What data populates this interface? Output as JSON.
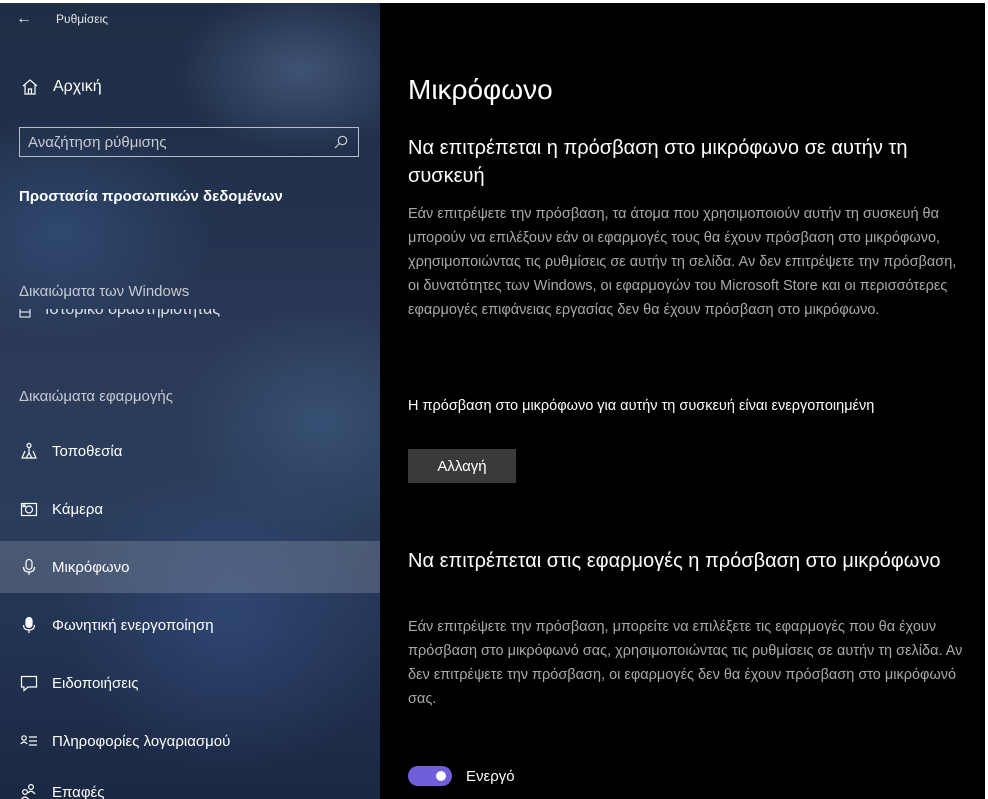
{
  "sidebar": {
    "window_title": "Ρυθμίσεις",
    "home_label": "Αρχική",
    "search_placeholder": "Αναζήτηση ρύθμισης",
    "section_title": "Προστασία προσωπικών δεδομένων",
    "windows_permissions_label": "Δικαιώματα των Windows",
    "activity_history_label": "Ιστορικό δραστηριότητας",
    "app_permissions_label": "Δικαιώματα εφαρμογής",
    "items": [
      {
        "label": "Τοποθεσία",
        "icon": "location-icon"
      },
      {
        "label": "Κάμερα",
        "icon": "camera-icon"
      },
      {
        "label": "Μικρόφωνο",
        "icon": "microphone-icon",
        "selected": true
      },
      {
        "label": "Φωνητική ενεργοποίηση",
        "icon": "voice-activation-icon"
      },
      {
        "label": "Ειδοποιήσεις",
        "icon": "notifications-icon"
      },
      {
        "label": "Πληροφορίες λογαριασμού",
        "icon": "account-info-icon"
      },
      {
        "label": "Επαφές",
        "icon": "contacts-icon"
      }
    ]
  },
  "main": {
    "page_title": "Μικρόφωνο",
    "device_section": {
      "title": "Να επιτρέπεται η πρόσβαση στο μικρόφωνο σε αυτήν τη συσκευή",
      "description": "Εάν επιτρέψετε την πρόσβαση, τα άτομα που χρησιμοποιούν αυτήν τη συσκευή θα μπορούν να επιλέξουν εάν οι εφαρμογές τους θα έχουν πρόσβαση στο μικρόφωνο, χρησιμοποιώντας τις ρυθμίσεις σε αυτήν τη σελίδα. Αν δεν επιτρέψετε την πρόσβαση, οι δυνατότητες των Windows, οι εφαρμογών του Microsoft Store και οι περισσότερες εφαρμογές επιφάνειας εργασίας δεν θα έχουν πρόσβαση στο μικρόφωνο.",
      "status": "Η πρόσβαση στο μικρόφωνο για αυτήν τη συσκευή είναι ενεργοποιημένη",
      "change_button": "Αλλαγή"
    },
    "apps_section": {
      "title": "Να επιτρέπεται στις εφαρμογές η πρόσβαση στο μικρόφωνο",
      "description": "Εάν επιτρέψετε την πρόσβαση, μπορείτε να επιλέξετε τις εφαρμογές που θα έχουν πρόσβαση στο μικρόφωνό σας, χρησιμοποιώντας τις ρυθμίσεις σε αυτήν τη σελίδα. Αν δεν επιτρέψετε την πρόσβαση, οι εφαρμογές δεν θα έχουν πρόσβαση στο μικρόφωνό σας.",
      "toggle_label": "Ενεργό",
      "toggle_on": true
    }
  },
  "colors": {
    "accent": "#6d60d8",
    "background": "#000000",
    "description_text": "#a9a9a9",
    "button_bg": "#3a3a3a"
  }
}
